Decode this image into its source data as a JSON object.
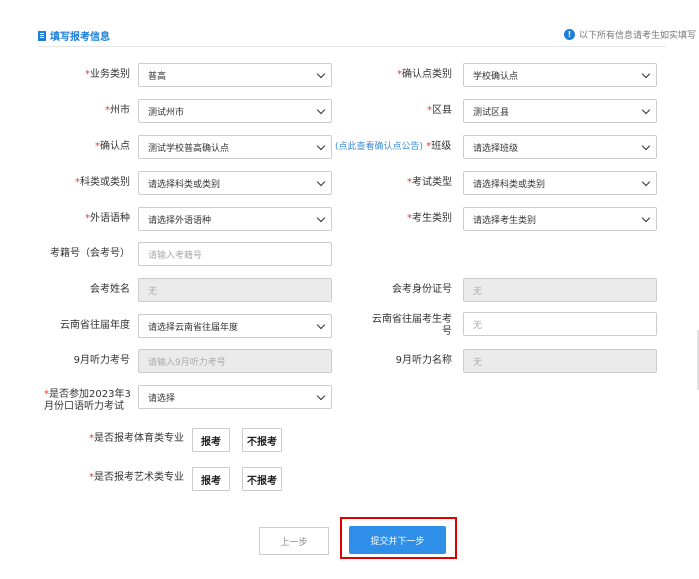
{
  "header": {
    "title": "填写报考信息",
    "note": "以下所有信息请考生如实填写"
  },
  "fields": {
    "business_type": {
      "label": "业务类别",
      "value": "普高"
    },
    "confirm_type": {
      "label": "确认点类别",
      "value": "学校确认点"
    },
    "city": {
      "label": "州市",
      "value": "测试州市"
    },
    "district": {
      "label": "区县",
      "value": "测试区县"
    },
    "confirm_point": {
      "label": "确认点",
      "value": "测试学校普高确认点",
      "link": "(点此查看确认点公告)"
    },
    "class": {
      "label": "班级",
      "value": "请选择班级"
    },
    "subject_type": {
      "label": "科类或类别",
      "value": "请选择科类或类别"
    },
    "exam_type": {
      "label": "考试类型",
      "value": "请选择科类或类别"
    },
    "foreign_lang": {
      "label": "外语语种",
      "value": "请选择外语语种"
    },
    "student_type": {
      "label": "考生类别",
      "value": "请选择考生类别"
    },
    "exam_number": {
      "label": "考籍号（会考号）",
      "placeholder": "请输入考籍号"
    },
    "hk_name": {
      "label": "会考姓名",
      "value": "无"
    },
    "hk_id": {
      "label": "会考身份证号",
      "value": "无"
    },
    "yn_year": {
      "label": "云南省往届年度",
      "value": "请选择云南省往届年度"
    },
    "yn_number": {
      "label_line1": "云南省往届考生考",
      "label_line2": "号",
      "value": "无"
    },
    "sep_number": {
      "label": "9月听力考号",
      "placeholder": "请输入9月听力考号"
    },
    "sep_name": {
      "label": "9月听力名称",
      "value": "无"
    },
    "oral_exam": {
      "label_line1": "是否参加2023年3",
      "label_line2": "月份口语听力考试",
      "value": "请选择"
    },
    "sports": {
      "label": "是否报考体育类专业",
      "yes": "报考",
      "no": "不报考"
    },
    "arts": {
      "label": "是否报考艺术类专业",
      "yes": "报考",
      "no": "不报考"
    }
  },
  "footer": {
    "prev": "上一步",
    "submit": "提交并下一步"
  },
  "required_mark": "*",
  "colors": {
    "accent": "#1e7fd8",
    "submit": "#2f8ee8",
    "highlight": "#e00000",
    "required": "#e53935"
  }
}
